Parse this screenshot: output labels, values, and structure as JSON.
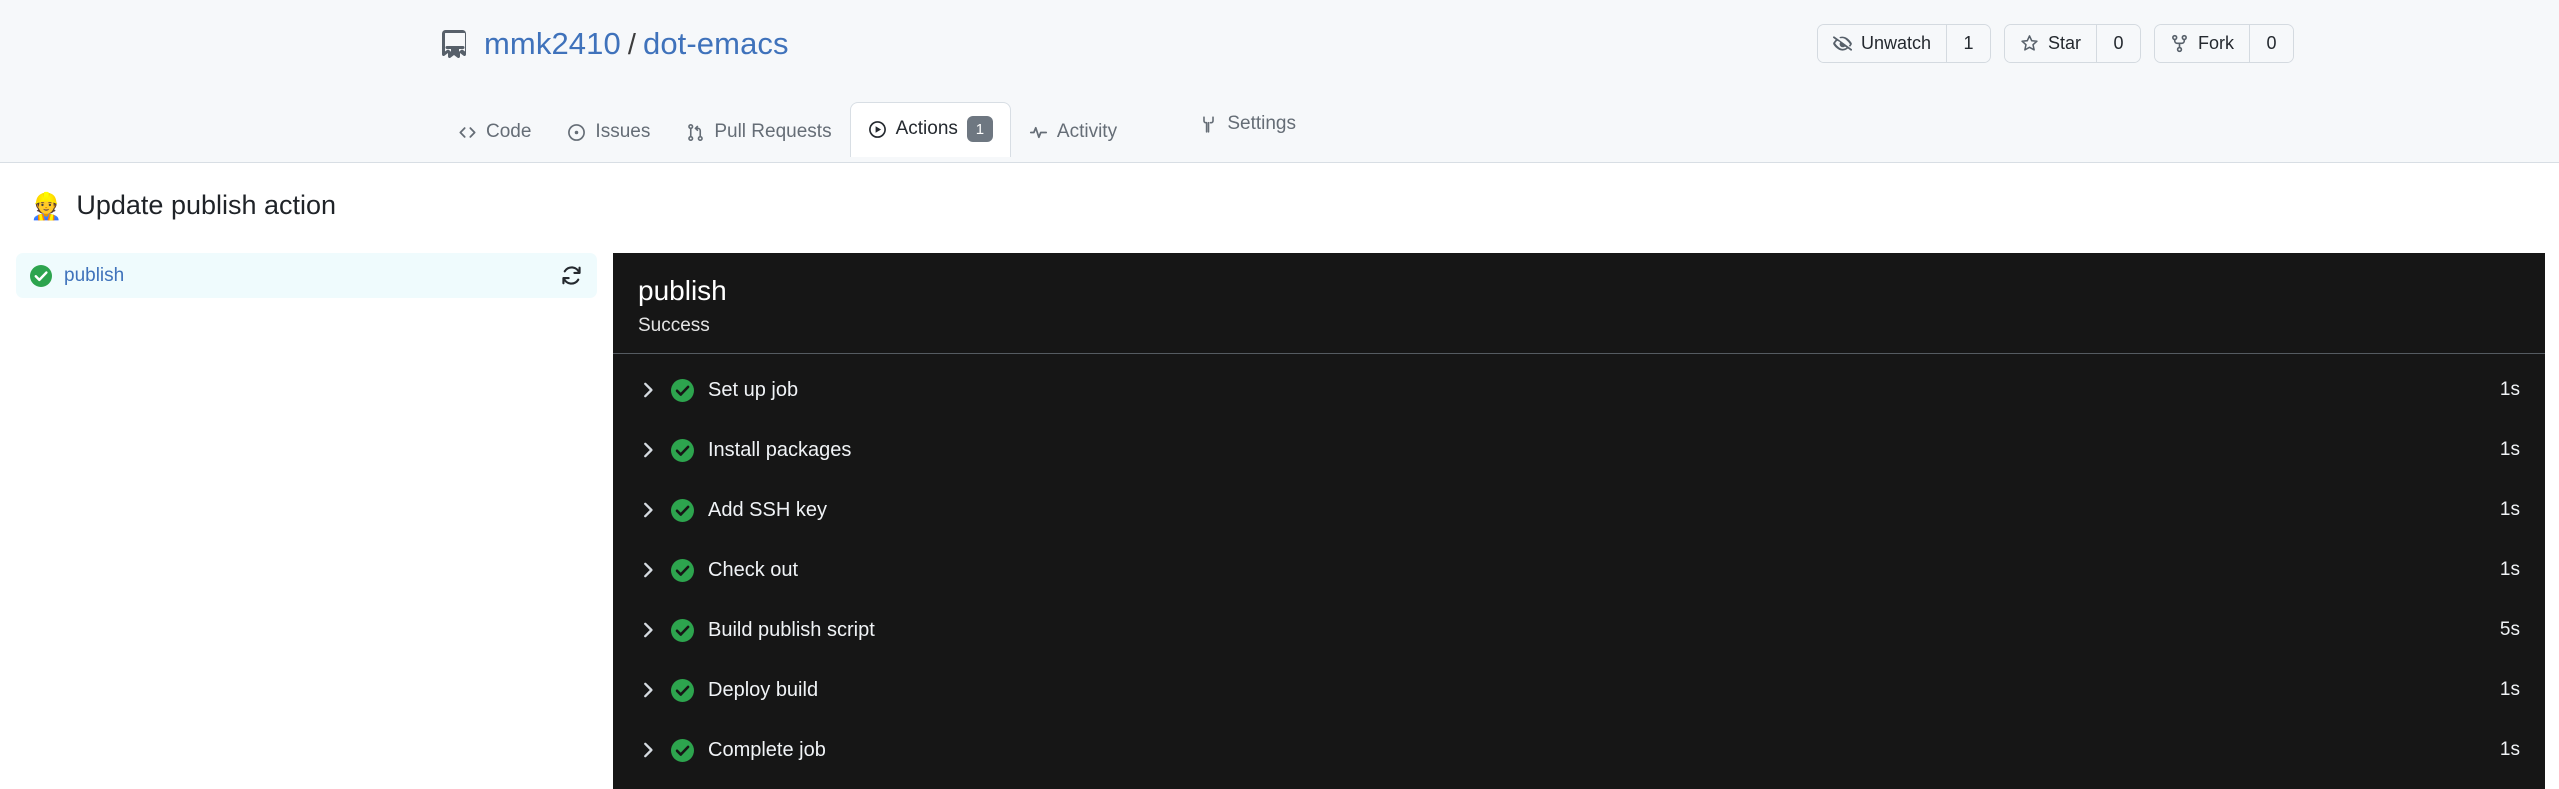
{
  "repo": {
    "icon": "repo-book-icon",
    "owner": "mmk2410",
    "separator": "/",
    "name": "dot-emacs"
  },
  "repo_actions": [
    {
      "icon": "eye-closed-icon",
      "label": "Unwatch",
      "count": "1"
    },
    {
      "icon": "star-icon",
      "label": "Star",
      "count": "0"
    },
    {
      "icon": "fork-icon",
      "label": "Fork",
      "count": "0"
    }
  ],
  "nav": {
    "tabs": [
      {
        "icon": "code-icon",
        "label": "Code",
        "badge": "",
        "active": false
      },
      {
        "icon": "issue-opened-icon",
        "label": "Issues",
        "badge": "",
        "active": false
      },
      {
        "icon": "git-pull-request-icon",
        "label": "Pull Requests",
        "badge": "",
        "active": false
      },
      {
        "icon": "play-circle-icon",
        "label": "Actions",
        "badge": "1",
        "active": true
      },
      {
        "icon": "pulse-icon",
        "label": "Activity",
        "badge": "",
        "active": false
      }
    ],
    "settings": {
      "icon": "tools-icon",
      "label": "Settings"
    }
  },
  "run": {
    "emoji": "👷",
    "title": "Update publish action"
  },
  "sidebar": {
    "jobs": [
      {
        "status_icon": "check-circle-icon",
        "name": "publish",
        "rerun_icon": "rerun-icon"
      }
    ]
  },
  "job": {
    "title": "publish",
    "status": "Success",
    "steps": [
      {
        "chevron": "chevron-right-icon",
        "status_icon": "check-circle-icon",
        "name": "Set up job",
        "duration": "1s"
      },
      {
        "chevron": "chevron-right-icon",
        "status_icon": "check-circle-icon",
        "name": "Install packages",
        "duration": "1s"
      },
      {
        "chevron": "chevron-right-icon",
        "status_icon": "check-circle-icon",
        "name": "Add SSH key",
        "duration": "1s"
      },
      {
        "chevron": "chevron-right-icon",
        "status_icon": "check-circle-icon",
        "name": "Check out",
        "duration": "1s"
      },
      {
        "chevron": "chevron-right-icon",
        "status_icon": "check-circle-icon",
        "name": "Build publish script",
        "duration": "5s"
      },
      {
        "chevron": "chevron-right-icon",
        "status_icon": "check-circle-icon",
        "name": "Deploy build",
        "duration": "1s"
      },
      {
        "chevron": "chevron-right-icon",
        "status_icon": "check-circle-icon",
        "name": "Complete job",
        "duration": "1s"
      }
    ]
  },
  "colors": {
    "header_bg": "#f6f8fa",
    "link": "#3f72bb",
    "log_bg": "#161616",
    "success_green": "#2da44e",
    "sidebar_highlight": "#effbfd",
    "badge_gray": "#6e7781"
  }
}
